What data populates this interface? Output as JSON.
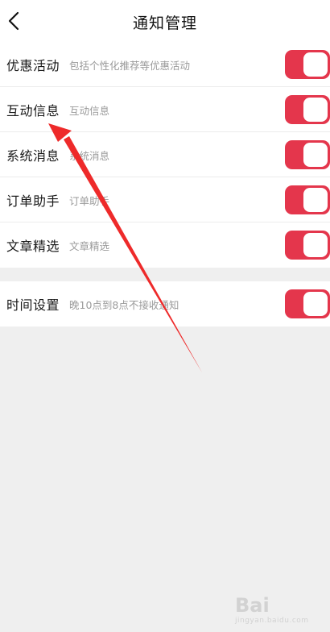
{
  "header": {
    "title": "通知管理",
    "back_icon": "chevron-left-icon"
  },
  "settings": [
    {
      "label": "优惠活动",
      "desc": "包括个性化推荐等优惠活动",
      "enabled": true
    },
    {
      "label": "互动信息",
      "desc": "互动信息",
      "enabled": true
    },
    {
      "label": "系统消息",
      "desc": "系统消息",
      "enabled": true
    },
    {
      "label": "订单助手",
      "desc": "订单助手",
      "enabled": true
    },
    {
      "label": "文章精选",
      "desc": "文章精选",
      "enabled": true
    }
  ],
  "time_setting": {
    "label": "时间设置",
    "desc": "晚10点到8点不接收通知",
    "enabled": true
  },
  "colors": {
    "accent": "#e4364c",
    "background": "#efefef",
    "annotation_arrow": "#ee2a2a"
  },
  "watermark": {
    "brand": "Bai",
    "sub": "jingyan.baidu.com"
  }
}
